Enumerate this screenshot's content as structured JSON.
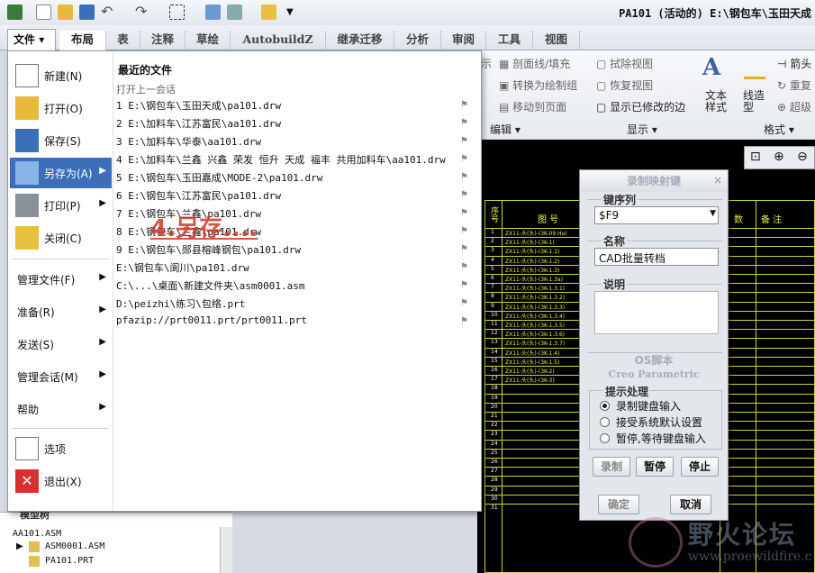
{
  "window": {
    "title": "PA101 (活动的) E:\\钢包车\\玉田天成"
  },
  "tabs": [
    "文件",
    "布局",
    "表",
    "注释",
    "草绘",
    "AutobuildZ",
    "继承迁移",
    "分析",
    "审阅",
    "工具",
    "视图"
  ],
  "ribbon": {
    "buttons": [
      "剖面线/填充",
      "转换为绘制组",
      "移动到页面",
      "拭除视图",
      "恢复视图",
      "显示已修改的边",
      "文本样式",
      "线造型",
      "箭头",
      "重复",
      "超级"
    ],
    "groups": [
      "编辑",
      "显示",
      "格式"
    ],
    "partial": "示"
  },
  "file_menu": {
    "left_items": [
      "新建(N)",
      "打开(O)",
      "保存(S)",
      "另存为(A)",
      "打印(P)",
      "关闭(C)"
    ],
    "section_items": [
      "管理文件(F)",
      "准备(R)",
      "发送(S)",
      "管理会话(M)",
      "帮助"
    ],
    "bottom_items": [
      "选项",
      "退出(X)"
    ],
    "recent_title": "最近的文件",
    "recent_subtitle": "打开上一会话",
    "recent_files": [
      "1 E:\\钢包车\\玉田天成\\pa101.drw",
      "2 E:\\加料车\\江苏富民\\aa101.drw",
      "3 E:\\加料车\\华泰\\aa101.drw",
      "4 E:\\加料车\\兰鑫 兴鑫 荣发 恒升 天成 福丰 共用加料车\\aa101.drw",
      "5 E:\\钢包车\\玉田嘉成\\MODE-2\\pa101.drw",
      "6 E:\\钢包车\\江苏富民\\pa101.drw",
      "7 E:\\钢包车\\兰鑫\\pa101.drw",
      "8 E:\\钢包车\\兰鑫\\pa101.drw",
      "9 E:\\钢包车\\郧县榕峰钢包\\pa101.drw",
      "E:\\钢包车\\阆川\\pa101.drw",
      "C:\\...\\桌面\\新建文件夹\\asm0001.asm",
      "D:\\peizhi\\练习\\包络.prt",
      "pfazip://prt0011.prt/prt0011.prt"
    ],
    "annotation": "4.另存...."
  },
  "dialog": {
    "title": "录制映射键",
    "key_sequence_label": "键序列",
    "key_sequence_value": "$F9",
    "name_label": "名称",
    "name_value": "CAD批量转档",
    "desc_label": "说明",
    "os_label": "OS脚本",
    "creo_label": "Creo Parametric",
    "prompt_label": "提示处理",
    "options": [
      "录制键盘输入",
      "接受系统默认设置",
      "暂停,等待键盘输入"
    ],
    "selected_option": 0,
    "buttons": [
      "录制",
      "暂停",
      "停止"
    ],
    "ok": "确定",
    "cancel": "取消"
  },
  "table": {
    "headers": [
      "序号",
      "图 号",
      "数",
      "备 注"
    ],
    "rows": [
      "ZX11-头(头)-(3K-09 Ha)",
      "ZX11-头(头)-(3K-1)",
      "ZX11-头(头)-(3K-1.1)",
      "ZX11-头(头)-(3K-1.2)",
      "ZX11-头(头)-(3K-1.3)",
      "ZX11-头(头)-(3K-1.3a)",
      "ZX11-头(头)-(3K-1.3.1)",
      "ZX11-头(头)-(3K-1.3.2)",
      "ZX11-头(头)-(3K-1.3.3)",
      "ZX11-头(头)-(3K-1.3.4)",
      "ZX11-头(头)-(3K-1.3.5)",
      "ZX11-头(头)-(3K-1.3.6)",
      "ZX11-头(头)-(3K-1.3.7)",
      "ZX11-头(头)-(3K-1.4)",
      "ZX11-头(头)-(3K-1.5)",
      "ZX11-头(头)-(3K-2)",
      "ZX11-头(头)-(3K-3)"
    ],
    "row_count": 31
  },
  "tree": {
    "header": "模型树",
    "items": [
      "AA101.ASM",
      "ASM0001.ASM",
      "PA101.PRT"
    ]
  },
  "watermark": {
    "text": "野火论坛",
    "url": "www.proewildfire.c"
  }
}
